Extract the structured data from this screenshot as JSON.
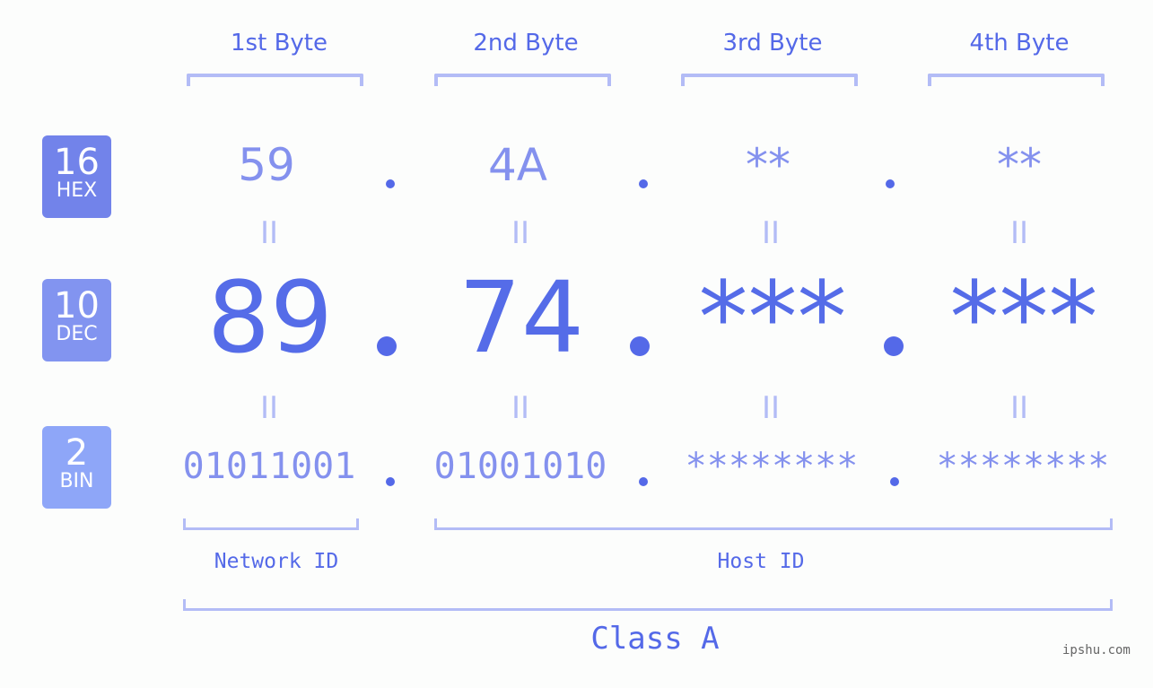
{
  "columns": [
    "1st Byte",
    "2nd Byte",
    "3rd Byte",
    "4th Byte"
  ],
  "badges": {
    "hex": {
      "num": "16",
      "label": "HEX"
    },
    "dec": {
      "num": "10",
      "label": "DEC"
    },
    "bin": {
      "num": "2",
      "label": "BIN"
    }
  },
  "hex": [
    "59",
    "4A",
    "**",
    "**"
  ],
  "dec": [
    "89",
    "74",
    "***",
    "***"
  ],
  "bin": [
    "01011001",
    "01001010",
    "********",
    "********"
  ],
  "equals": "II",
  "network_id_label": "Network ID",
  "host_id_label": "Host ID",
  "class_label": "Class A",
  "watermark": "ipshu.com",
  "colors": {
    "accent": "#5469e8",
    "light": "#b3bcf6",
    "hex_badge": "#7283ea",
    "dec_badge": "#8294f0",
    "bin_badge": "#8ea6f8"
  }
}
